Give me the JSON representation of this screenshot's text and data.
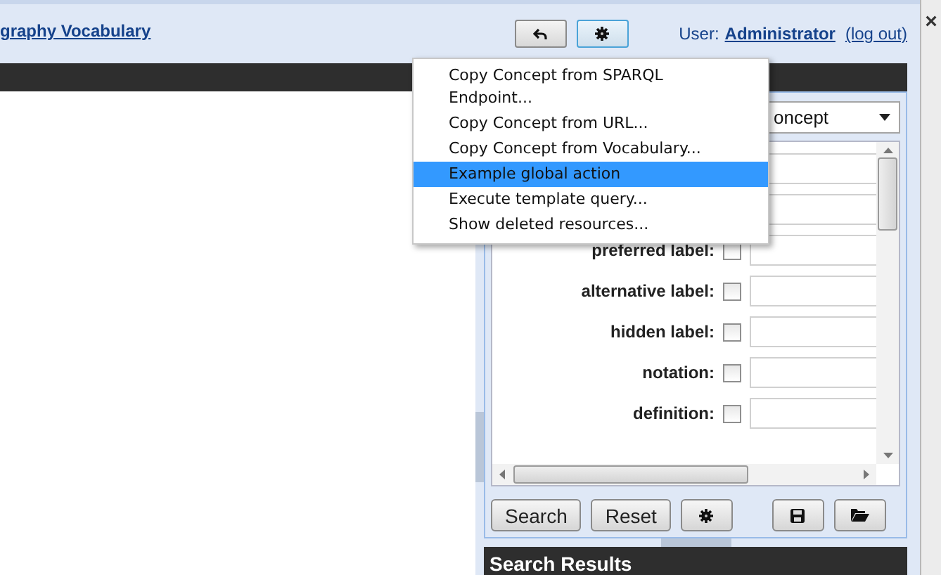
{
  "header": {
    "title_link": "graphy Vocabulary",
    "user_label": "User:",
    "user_name": "Administrator",
    "logout": "(log out)"
  },
  "type_select": {
    "value": "oncept"
  },
  "menu": {
    "items": [
      {
        "label": "Copy Concept from SPARQL Endpoint...",
        "selected": false
      },
      {
        "label": "Copy Concept from URL...",
        "selected": false
      },
      {
        "label": "Copy Concept from Vocabulary...",
        "selected": false
      },
      {
        "label": "Example global action",
        "selected": true
      },
      {
        "label": "Execute template query...",
        "selected": false
      },
      {
        "label": "Show deleted resources...",
        "selected": false
      }
    ]
  },
  "search_fields": [
    {
      "label": "preferred label:",
      "checked": false
    },
    {
      "label": "alternative label:",
      "checked": false
    },
    {
      "label": "hidden label:",
      "checked": false
    },
    {
      "label": "notation:",
      "checked": false
    },
    {
      "label": "definition:",
      "checked": false
    }
  ],
  "buttons": [
    {
      "kind": "text",
      "label": "Search"
    },
    {
      "kind": "text",
      "label": "Reset"
    },
    {
      "kind": "gear"
    },
    {
      "kind": "spacer"
    },
    {
      "kind": "save"
    },
    {
      "kind": "folder"
    }
  ],
  "results_title": "Search Results",
  "close_glyph": "×"
}
